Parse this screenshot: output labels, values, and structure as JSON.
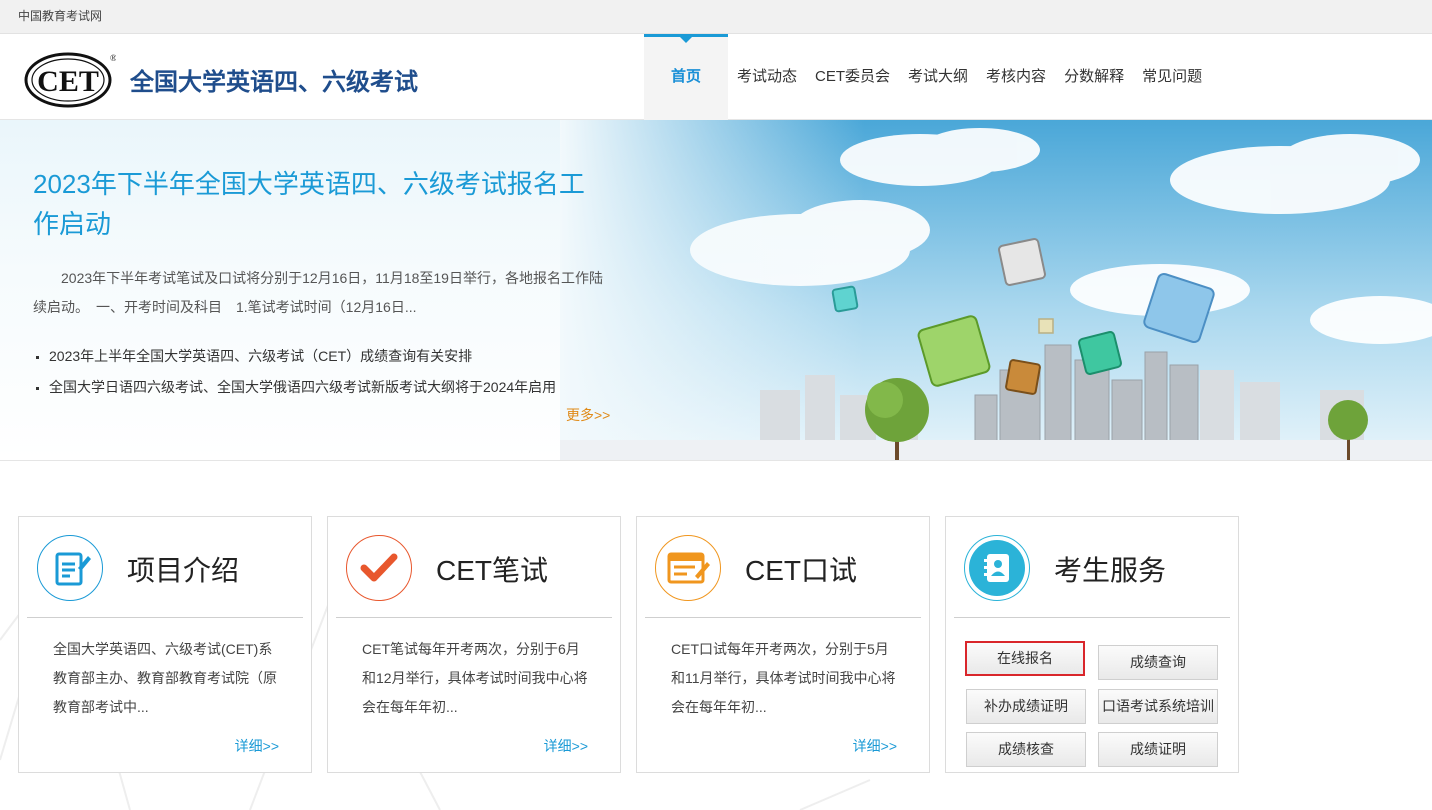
{
  "topbar": {
    "site_name": "中国教育考试网"
  },
  "header": {
    "logo_text": "CET",
    "logo_mark": "®",
    "site_title": "全国大学英语四、六级考试"
  },
  "nav": {
    "items": [
      {
        "label": "首页"
      },
      {
        "label": "考试动态"
      },
      {
        "label": "CET委员会"
      },
      {
        "label": "考试大纲"
      },
      {
        "label": "考核内容"
      },
      {
        "label": "分数解释"
      },
      {
        "label": "常见问题"
      }
    ]
  },
  "banner": {
    "headline": "2023年下半年全国大学英语四、六级考试报名工作启动",
    "summary": "2023年下半年考试笔试及口试将分别于12月16日，11月18至19日举行，各地报名工作陆续启动。　一、开考时间及科目　1.笔试考试时间（12月16日...",
    "news": [
      {
        "title": "2023年上半年全国大学英语四、六级考试（CET）成绩查询有关安排"
      },
      {
        "title": "全国大学日语四六级考试、全国大学俄语四六级考试新版考试大纲将于2024年启用"
      }
    ],
    "more": "更多>>"
  },
  "cards": [
    {
      "icon": "document-pen-icon",
      "color": "#1a9ad6",
      "title": "项目介绍",
      "desc": "全国大学英语四、六级考试(CET)系教育部主办、教育部教育考试院（原教育部考试中...",
      "more": "详细>>"
    },
    {
      "icon": "checkmark-icon",
      "color": "#e8572d",
      "title": "CET笔试",
      "desc": "CET笔试每年开考两次，分别于6月和12月举行，具体考试时间我中心将会在每年年初...",
      "more": "详细>>"
    },
    {
      "icon": "form-pencil-icon",
      "color": "#f0961e",
      "title": "CET口试",
      "desc": "CET口试每年开考两次，分别于5月和11月举行，具体考试时间我中心将会在每年年初...",
      "more": "详细>>"
    },
    {
      "icon": "contact-book-icon",
      "color": "#2bb3d8",
      "title": "考生服务",
      "buttons": [
        {
          "label": "在线报名",
          "selected": true
        },
        {
          "label": "成绩查询"
        },
        {
          "label": "补办成绩证明"
        },
        {
          "label": "口语考试系统培训"
        },
        {
          "label": "成绩核查"
        },
        {
          "label": "成绩证明"
        }
      ]
    }
  ]
}
